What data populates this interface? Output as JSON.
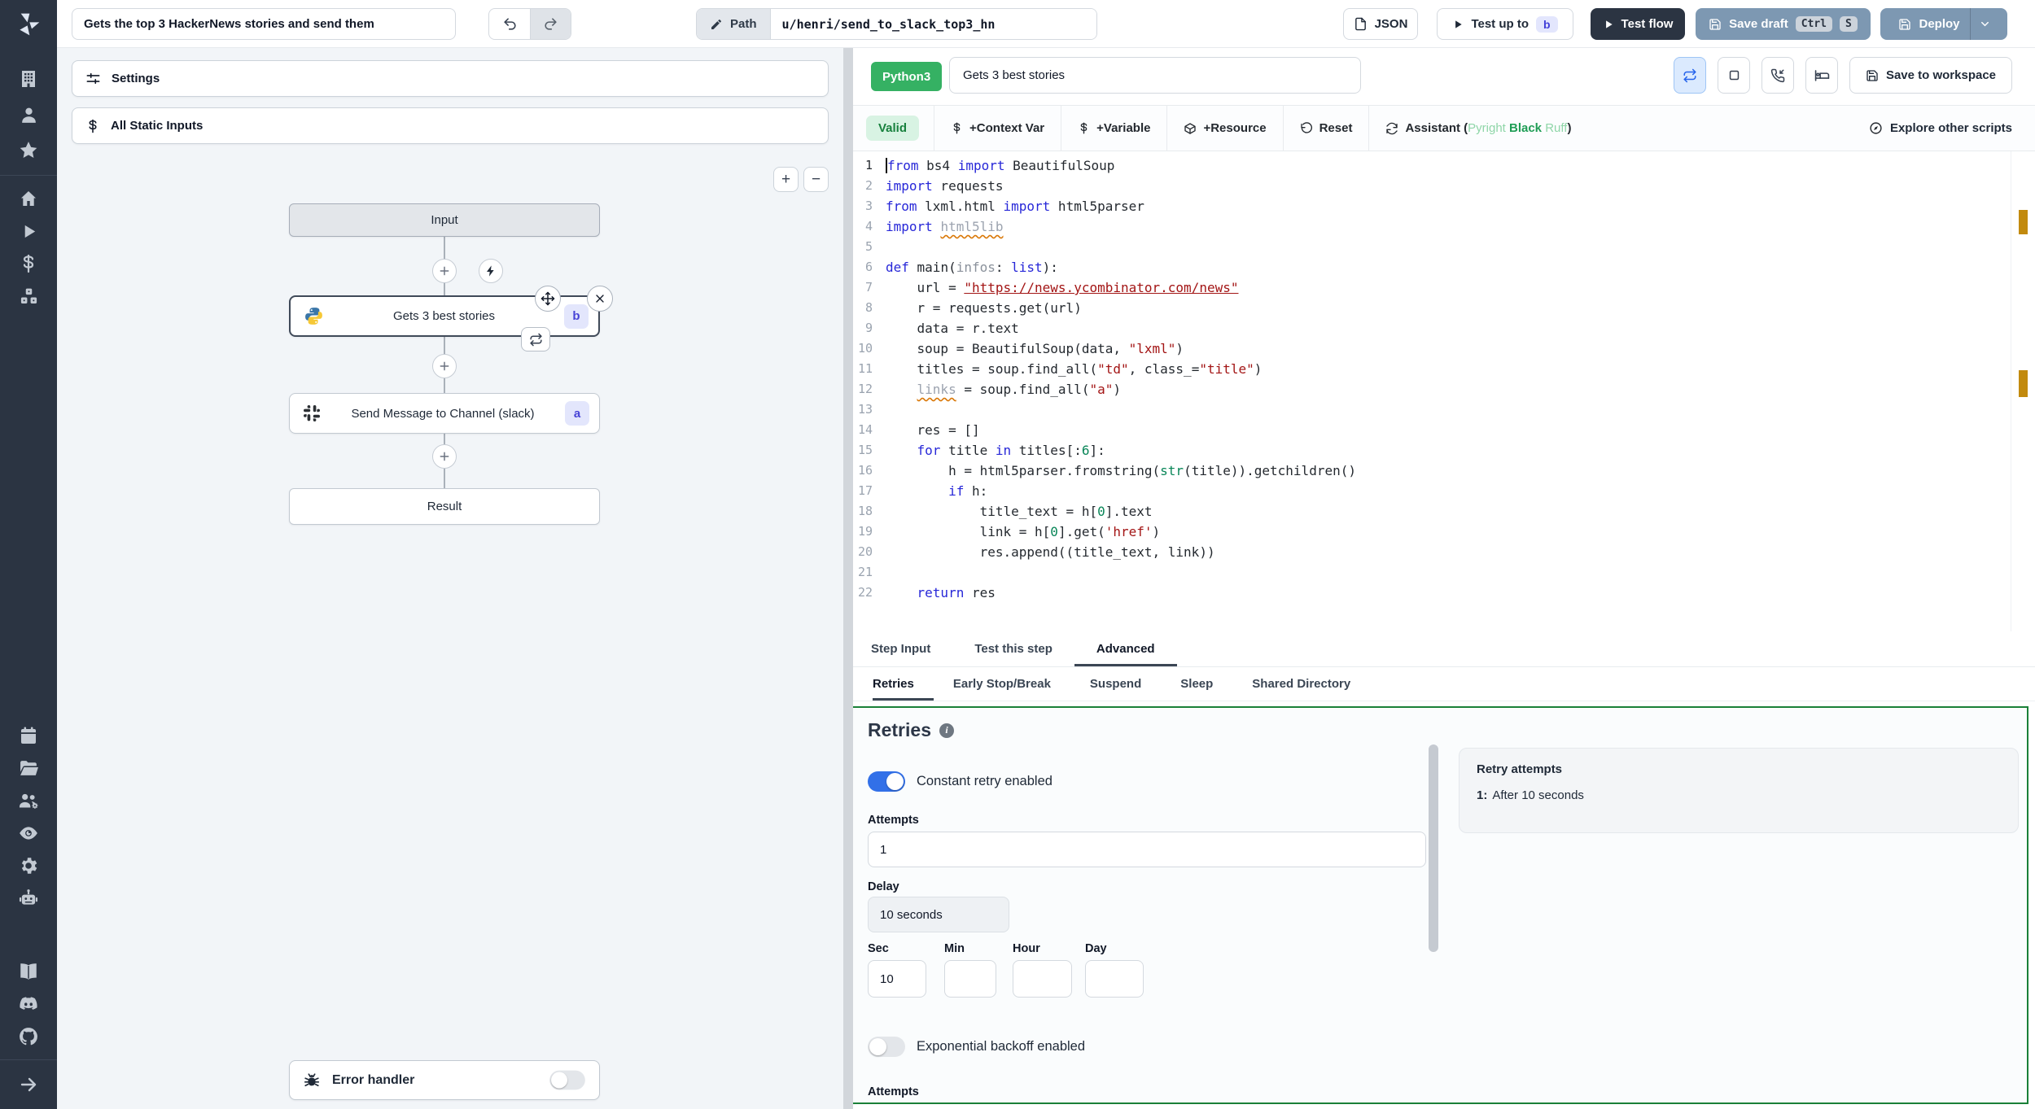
{
  "topbar": {
    "flow_title": "Gets the top 3 HackerNews stories and send them",
    "path_label": "Path",
    "path_value": "u/henri/send_to_slack_top3_hn",
    "json_button": "JSON",
    "test_up_to": "Test up to",
    "test_up_to_badge": "b",
    "test_flow": "Test flow",
    "save_draft": "Save draft",
    "save_draft_keys": [
      "Ctrl",
      "S"
    ],
    "deploy": "Deploy"
  },
  "sidebar": {
    "icons": [
      "workspace-building",
      "user",
      "favorites-star",
      "home",
      "runs-play",
      "variables-dollar",
      "resources-cubes",
      "schedules-calendar",
      "folders",
      "groups",
      "audit-eye",
      "settings-gear",
      "workers-robot",
      "docs-book",
      "discord",
      "github",
      "collapse-arrow"
    ]
  },
  "flow_panel": {
    "settings_label": "Settings",
    "static_inputs_label": "All Static Inputs",
    "zoom_in": "+",
    "zoom_out": "−",
    "nodes": {
      "input": "Input",
      "step_b_label": "Gets 3 best stories",
      "step_b_badge": "b",
      "step_a_label": "Send Message to Channel (slack)",
      "step_a_badge": "a",
      "result": "Result",
      "error_handler": "Error handler"
    }
  },
  "editor": {
    "language_badge": "Python3",
    "step_name": "Gets 3 best stories",
    "save_to_workspace": "Save to workspace",
    "toolbar": {
      "valid": "Valid",
      "context_var": "+Context Var",
      "variable": "+Variable",
      "resource": "+Resource",
      "reset": "Reset",
      "assistant_prefix": "Assistant (",
      "assistant_tools": [
        "Pyright",
        "Black",
        "Ruff"
      ],
      "assistant_suffix": ")",
      "explore": "Explore other scripts"
    },
    "code": {
      "active_line": 1,
      "lines": [
        [
          [
            "kw",
            "from"
          ],
          [
            "d",
            " bs4 "
          ],
          [
            "kw",
            "import"
          ],
          [
            "d",
            " BeautifulSoup"
          ]
        ],
        [
          [
            "kw",
            "import"
          ],
          [
            "d",
            " requests"
          ]
        ],
        [
          [
            "kw",
            "from"
          ],
          [
            "d",
            " lxml.html "
          ],
          [
            "kw",
            "import"
          ],
          [
            "d",
            " html5parser"
          ]
        ],
        [
          [
            "kw",
            "import"
          ],
          [
            "d",
            " "
          ],
          [
            "un",
            "html5lib"
          ]
        ],
        [],
        [
          [
            "kw",
            "def"
          ],
          [
            "d",
            " main("
          ],
          [
            "par",
            "infos"
          ],
          [
            "d",
            ": "
          ],
          [
            "kw",
            "list"
          ],
          [
            "d",
            "):"
          ]
        ],
        [
          [
            "d",
            "    url = "
          ],
          [
            "strl",
            "\"https://news.ycombinator.com/news\""
          ]
        ],
        [
          [
            "d",
            "    r = requests.get(url)"
          ]
        ],
        [
          [
            "d",
            "    data = r.text"
          ]
        ],
        [
          [
            "d",
            "    soup = BeautifulSoup(data, "
          ],
          [
            "str",
            "\"lxml\""
          ],
          [
            "d",
            ")"
          ]
        ],
        [
          [
            "d",
            "    titles = soup.find_all("
          ],
          [
            "str",
            "\"td\""
          ],
          [
            "d",
            ", class_="
          ],
          [
            "str",
            "\"title\""
          ],
          [
            "d",
            ")"
          ]
        ],
        [
          [
            "d",
            "    "
          ],
          [
            "un",
            "links"
          ],
          [
            "d",
            " = soup.find_all("
          ],
          [
            "str",
            "\"a\""
          ],
          [
            "d",
            ")"
          ]
        ],
        [],
        [
          [
            "d",
            "    res = []"
          ]
        ],
        [
          [
            "d",
            "    "
          ],
          [
            "kw",
            "for"
          ],
          [
            "d",
            " title "
          ],
          [
            "kw",
            "in"
          ],
          [
            "d",
            " titles[:"
          ],
          [
            "num",
            "6"
          ],
          [
            "d",
            "]:"
          ]
        ],
        [
          [
            "d",
            "        h = html5parser.fromstring("
          ],
          [
            "fn",
            "str"
          ],
          [
            "d",
            "(title)).getchildren()"
          ]
        ],
        [
          [
            "d",
            "        "
          ],
          [
            "kw",
            "if"
          ],
          [
            "d",
            " h:"
          ]
        ],
        [
          [
            "d",
            "            title_text = h["
          ],
          [
            "num",
            "0"
          ],
          [
            "d",
            "].text"
          ]
        ],
        [
          [
            "d",
            "            link = h["
          ],
          [
            "num",
            "0"
          ],
          [
            "d",
            "].get("
          ],
          [
            "str",
            "'href'"
          ],
          [
            "d",
            ")"
          ]
        ],
        [
          [
            "d",
            "            res.append((title_text, link))"
          ]
        ],
        [],
        [
          [
            "d",
            "    "
          ],
          [
            "kw",
            "return"
          ],
          [
            "d",
            " res"
          ]
        ]
      ]
    }
  },
  "tabs": {
    "main": [
      "Step Input",
      "Test this step",
      "Advanced"
    ],
    "main_active": "Advanced",
    "sub": [
      "Retries",
      "Early Stop/Break",
      "Suspend",
      "Sleep",
      "Shared Directory"
    ],
    "sub_active": "Retries"
  },
  "retries": {
    "title": "Retries",
    "constant_retry_label": "Constant retry enabled",
    "constant_retry_enabled": true,
    "attempts_label": "Attempts",
    "attempts_value": "1",
    "delay_label": "Delay",
    "delay_value": "10 seconds",
    "unit_fields": [
      {
        "label": "Sec",
        "value": "10"
      },
      {
        "label": "Min",
        "value": ""
      },
      {
        "label": "Hour",
        "value": ""
      },
      {
        "label": "Day",
        "value": ""
      }
    ],
    "exponential_label": "Exponential backoff enabled",
    "exponential_enabled": false,
    "bottom_section_label": "Attempts",
    "summary": {
      "title": "Retry attempts",
      "items": [
        {
          "index": "1:",
          "text": "After 10 seconds"
        }
      ]
    }
  }
}
